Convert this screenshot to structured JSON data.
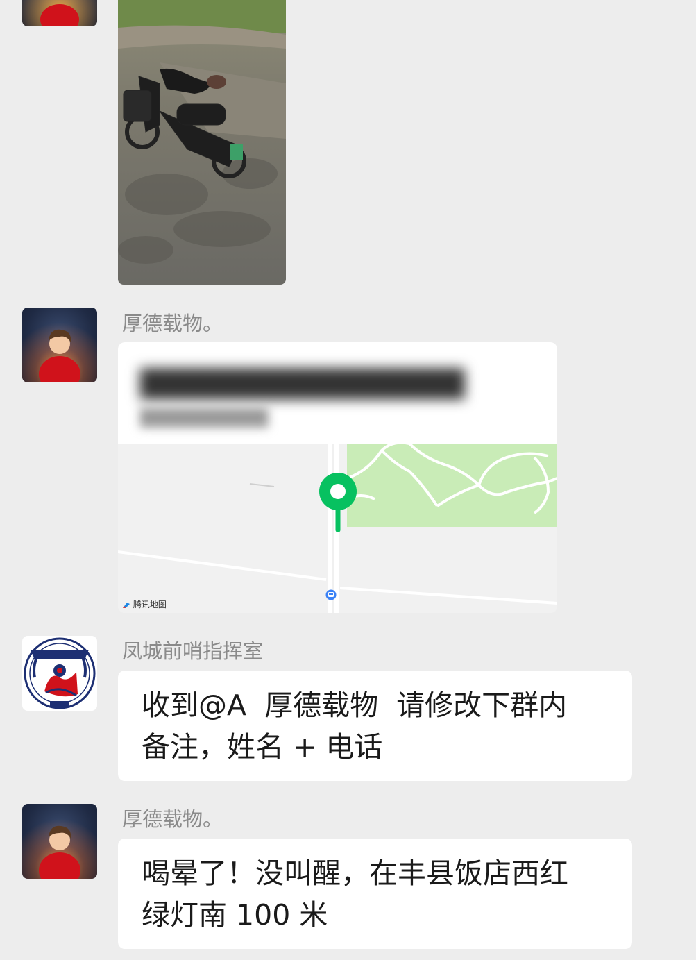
{
  "messages": [
    {
      "type": "image",
      "sender": "",
      "avatar": "avatar-person-red-sweater"
    },
    {
      "type": "location",
      "sender": "厚德载物。",
      "avatar": "avatar-person-red-sweater",
      "map_attribution": "腾讯地图",
      "pin_icon": "map-pin-icon",
      "bus_icon": "bus-stop-icon"
    },
    {
      "type": "text",
      "sender": "凤城前哨指挥室",
      "avatar": "police-emblem",
      "lines": [
        "收到@A  厚德载物  请修改下群内",
        "备注，姓名 + 电话"
      ]
    },
    {
      "type": "text",
      "sender": "厚德载物。",
      "avatar": "avatar-person-red-sweater",
      "lines": [
        "喝晕了！没叫醒，在丰县饭店西红",
        "绿灯南 100 米"
      ]
    }
  ],
  "colors": {
    "background": "#ededed",
    "bubble": "#ffffff",
    "sender_name": "#8a8a8a",
    "map_pin": "#07c160",
    "park_green": "#c9ecb7"
  }
}
